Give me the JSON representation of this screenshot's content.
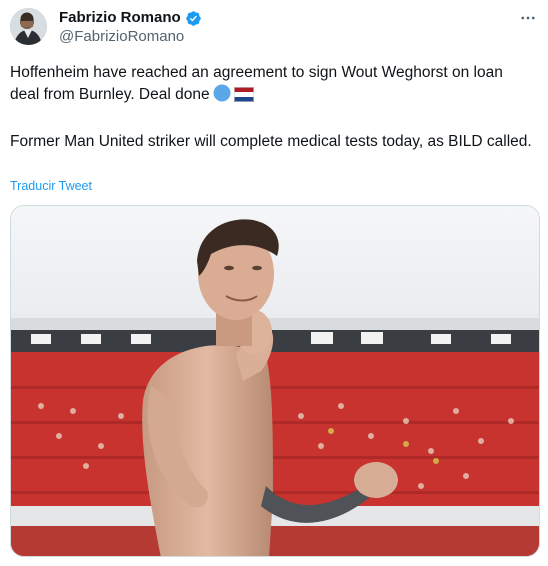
{
  "author": {
    "display_name": "Fabrizio Romano",
    "handle": "@FabrizioRomano",
    "avatar_icon": "avatar-photo",
    "verified_icon": "verified-badge-icon",
    "verified_color": "#1d9bf0"
  },
  "menu": {
    "more_icon": "more-options-icon"
  },
  "tweet": {
    "line1": "Hoffenheim have reached an agreement to sign Wout Weghorst on loan deal from Burnley. Deal done",
    "emojis": [
      "blue-circle-emoji",
      "netherlands-flag-emoji"
    ],
    "line2": "Former Man United striker will complete medical tests today, as BILD called."
  },
  "translate": {
    "label": "Traducir Tweet",
    "color": "#1d9bf0"
  },
  "media": {
    "description_icon": "photo-footballer-celebrating",
    "stand_color": "#c8322f"
  }
}
